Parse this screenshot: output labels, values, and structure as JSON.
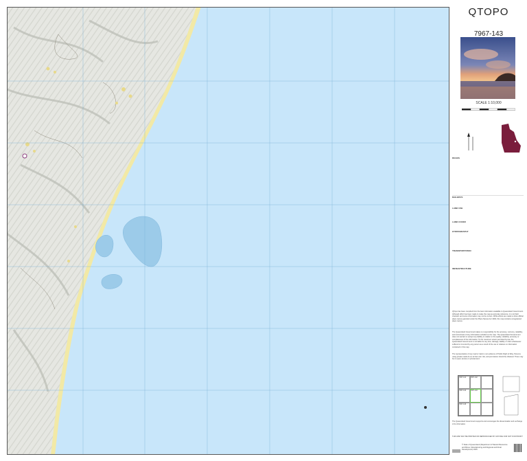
{
  "title": "QTOPO",
  "sheet_number": "7967-143",
  "scale_text": "SCALE 1:10,000",
  "colors": {
    "water": "#c8e6fa",
    "reef": "#9ccbe9",
    "land": "#e9eae5",
    "sand": "#f2e9a6",
    "grid": "#7ab0d6"
  },
  "legend_sections": [
    "ROADS",
    "RAILWAYS",
    "LAND USE",
    "LAND COVER",
    "HYDROGRAPHY",
    "TRANSPORTATION",
    "INFRASTRUCTURE"
  ],
  "disclaimer_paragraphs": [
    "QTopo has been compiled from the best information available to Queensland Government. Although effort has been made to make the map as accurate reference, it is not field checked, and some information may not be current. While efforts are made to show official place names gazetted under the Place Names Act 1994, this map contains unregistered place names.",
    "The Queensland Government takes no responsibility for the accuracy, currency, reliability, and correctness of any information included on the map. The Queensland Government does not warrant or accept any liability in relation to the quality, reliability, accuracy or completeness of the information. To the maximum extent permitted by law, the Queensland Government is not liable for any loss, damage, liability or claim whatsoever suffered or incurred by any person as a result of the use or reliance on information contained in this map.",
    "The representation of any road or track is not evidence of Public Right of Way. Persons using private roads do so at their own risk, and permission should be obtained. There may be no open access on private land.",
    "The Queensland Government supports and encourages the dissemination and exchange of its information."
  ],
  "copyright": "© State of Queensland (Department of Natural Resources and Mines, Manufacturing and Regional and Rural Development) 2025",
  "not_for_resale": "THIS MAP MAY BE PRINTED OR REPRODUCED BY ANYONE FOR NOT FOR PROFIT",
  "index_sheets": [
    "7967-141",
    "7967-142",
    "7967-143",
    "7967-144",
    "7967-146"
  ]
}
